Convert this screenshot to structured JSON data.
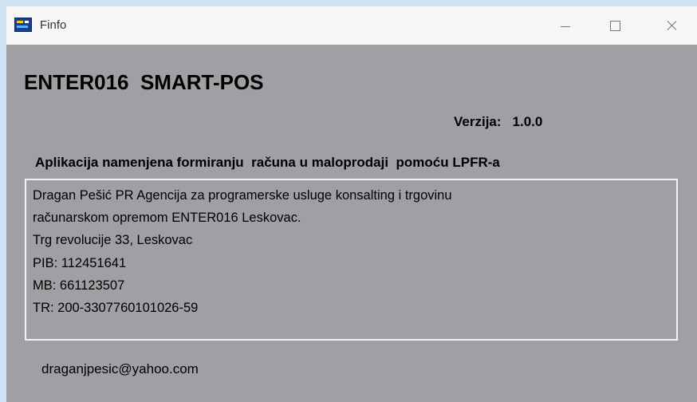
{
  "window": {
    "title": "Finfo",
    "minimize_icon": "minimize-icon",
    "maximize_icon": "maximize-icon",
    "close_icon": "close-icon"
  },
  "app": {
    "name": "ENTER016  SMART-POS",
    "version_label": "Verzija:",
    "version_value": "1.0.0",
    "description": "Aplikacija namenjena formiranju  računa u maloprodaji  pomoću LPFR-a"
  },
  "info": {
    "lines": [
      "Dragan Pešić PR Agencija za programerske usluge konsalting i trgovinu",
      "računarskom opremom ENTER016 Leskovac.",
      "Trg revolucije 33, Leskovac",
      "PIB: 112451641",
      "MB: 661123507",
      "TR:  200-3307760101026-59"
    ]
  },
  "contact": {
    "email": "draganjpesic@yahoo.com"
  },
  "colors": {
    "background": "#a0a0a4",
    "titlebar": "#f7f7f7",
    "desktop": "#cfe3f5"
  }
}
